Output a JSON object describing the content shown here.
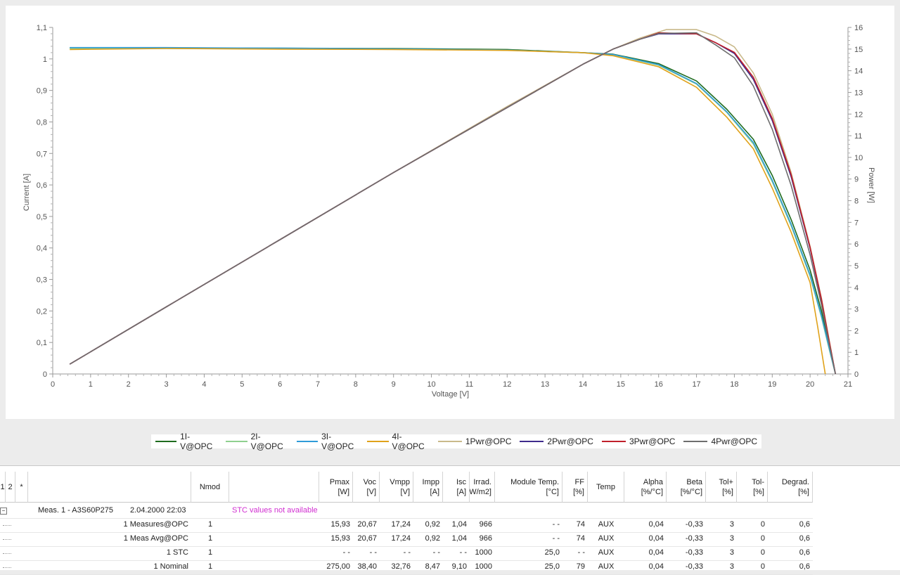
{
  "chart_data": {
    "type": "line",
    "xlabel": "Voltage [V]",
    "ylabel": "Current [A]",
    "y2label": "Power [W]",
    "xlim": [
      0,
      21
    ],
    "ylim": [
      0,
      1.1
    ],
    "y2lim": [
      0,
      16
    ],
    "x_ticks": [
      "0",
      "1",
      "2",
      "3",
      "4",
      "5",
      "6",
      "7",
      "8",
      "9",
      "10",
      "11",
      "12",
      "13",
      "14",
      "15",
      "16",
      "17",
      "18",
      "19",
      "20",
      "21"
    ],
    "y_ticks": [
      "0",
      "0,1",
      "0,2",
      "0,3",
      "0,4",
      "0,5",
      "0,6",
      "0,7",
      "0,8",
      "0,9",
      "1",
      "1,1"
    ],
    "y2_ticks": [
      "0",
      "1",
      "2",
      "3",
      "4",
      "5",
      "6",
      "7",
      "8",
      "9",
      "10",
      "11",
      "12",
      "13",
      "14",
      "15",
      "16"
    ],
    "grid": false,
    "legend_position": "bottom",
    "series": [
      {
        "name": "1I-V@OPC",
        "axis": "left",
        "color": "#1e6b1e",
        "x": [
          0.45,
          3,
          6,
          9,
          12,
          14,
          14.8,
          16,
          17,
          17.8,
          18.5,
          19,
          19.5,
          20,
          20.3,
          20.5,
          20.67
        ],
        "y": [
          1.035,
          1.035,
          1.034,
          1.033,
          1.03,
          1.02,
          1.015,
          0.985,
          0.93,
          0.84,
          0.745,
          0.63,
          0.49,
          0.33,
          0.2,
          0.09,
          0.0
        ]
      },
      {
        "name": "2I-V@OPC",
        "axis": "left",
        "color": "#8fd08f",
        "x": [
          0.45,
          3,
          6,
          9,
          12,
          14,
          14.8,
          16,
          17,
          17.8,
          18.5,
          19,
          19.5,
          20,
          20.3,
          20.5,
          20.67
        ],
        "y": [
          1.033,
          1.033,
          1.032,
          1.031,
          1.028,
          1.02,
          1.013,
          0.98,
          0.92,
          0.83,
          0.73,
          0.61,
          0.47,
          0.31,
          0.18,
          0.08,
          0.0
        ]
      },
      {
        "name": "3I-V@OPC",
        "axis": "left",
        "color": "#2f9bd8",
        "x": [
          0.45,
          3,
          6,
          9,
          12,
          14,
          14.8,
          16,
          17,
          17.8,
          18.5,
          19,
          19.5,
          20,
          20.3,
          20.5,
          20.67
        ],
        "y": [
          1.036,
          1.036,
          1.034,
          1.032,
          1.028,
          1.02,
          1.014,
          0.982,
          0.922,
          0.832,
          0.735,
          0.615,
          0.475,
          0.315,
          0.185,
          0.085,
          0.0
        ]
      },
      {
        "name": "4I-V@OPC",
        "axis": "left",
        "color": "#e0a21a",
        "x": [
          0.45,
          3,
          6,
          9,
          12,
          14,
          14.8,
          16,
          17,
          17.8,
          18.5,
          19,
          19.5,
          20,
          20.2,
          20.4
        ],
        "y": [
          1.03,
          1.033,
          1.031,
          1.03,
          1.027,
          1.02,
          1.01,
          0.975,
          0.91,
          0.815,
          0.715,
          0.59,
          0.45,
          0.29,
          0.15,
          0.0
        ]
      },
      {
        "name": "1Pwr@OPC",
        "axis": "right",
        "color": "#c9b98a",
        "x": [
          0.45,
          3,
          6,
          9,
          12,
          14,
          14.8,
          15.5,
          16.2,
          17,
          17.5,
          18,
          18.5,
          19,
          19.5,
          20,
          20.3,
          20.5,
          20.67
        ],
        "y": [
          0.45,
          3.1,
          6.2,
          9.3,
          12.35,
          14.3,
          15.0,
          15.5,
          15.9,
          15.9,
          15.6,
          15.1,
          13.9,
          12.0,
          9.3,
          5.9,
          3.5,
          1.6,
          0.0
        ]
      },
      {
        "name": "2Pwr@OPC",
        "axis": "right",
        "color": "#3f2b8c",
        "x": [
          0.45,
          3,
          6,
          9,
          12,
          14,
          14.8,
          15.5,
          16,
          17,
          17.5,
          18,
          18.5,
          19,
          19.5,
          20,
          20.3,
          20.5,
          20.67
        ],
        "y": [
          0.45,
          3.1,
          6.2,
          9.3,
          12.3,
          14.3,
          15.0,
          15.45,
          15.7,
          15.7,
          15.3,
          14.8,
          13.6,
          11.7,
          9.1,
          5.8,
          3.4,
          1.5,
          0.0
        ]
      },
      {
        "name": "3Pwr@OPC",
        "axis": "right",
        "color": "#c0202a",
        "x": [
          0.45,
          3,
          6,
          9,
          12,
          14,
          14.8,
          15.5,
          16,
          17,
          17.5,
          18,
          18.5,
          19,
          19.5,
          20,
          20.3,
          20.5,
          20.67
        ],
        "y": [
          0.45,
          3.1,
          6.2,
          9.3,
          12.3,
          14.3,
          15.0,
          15.45,
          15.75,
          15.7,
          15.3,
          14.85,
          13.7,
          11.8,
          9.2,
          5.85,
          3.45,
          1.55,
          0.0
        ]
      },
      {
        "name": "4Pwr@OPC",
        "axis": "right",
        "color": "#6e6e6e",
        "x": [
          0.45,
          3,
          6,
          9,
          12,
          14,
          14.8,
          15.5,
          16,
          17,
          17.5,
          18,
          18.5,
          19,
          19.5,
          20,
          20.3,
          20.5,
          20.67
        ],
        "y": [
          0.45,
          3.1,
          6.2,
          9.3,
          12.3,
          14.3,
          15.0,
          15.45,
          15.72,
          15.75,
          15.2,
          14.6,
          13.3,
          11.3,
          8.7,
          5.5,
          3.2,
          1.4,
          0.0
        ]
      }
    ]
  },
  "table": {
    "columns": [
      {
        "key": "c1",
        "label": "1",
        "unit": ""
      },
      {
        "key": "c2",
        "label": "2",
        "unit": ""
      },
      {
        "key": "c3",
        "label": "*",
        "unit": ""
      },
      {
        "key": "name",
        "label": "",
        "unit": ""
      },
      {
        "key": "nmod",
        "label": "Nmod",
        "unit": ""
      },
      {
        "key": "note",
        "label": "",
        "unit": ""
      },
      {
        "key": "pmax",
        "label": "Pmax",
        "unit": "[W]"
      },
      {
        "key": "voc",
        "label": "Voc",
        "unit": "[V]"
      },
      {
        "key": "vmpp",
        "label": "Vmpp",
        "unit": "[V]"
      },
      {
        "key": "impp",
        "label": "Impp",
        "unit": "[A]"
      },
      {
        "key": "isc",
        "label": "Isc",
        "unit": "[A]"
      },
      {
        "key": "irrad",
        "label": "Irrad.",
        "unit": "[W/m2]"
      },
      {
        "key": "mtemp",
        "label": "Module Temp.",
        "unit": "[°C]"
      },
      {
        "key": "ff",
        "label": "FF",
        "unit": "[%]"
      },
      {
        "key": "temp",
        "label": "Temp",
        "unit": ""
      },
      {
        "key": "alpha",
        "label": "Alpha",
        "unit": "[%/°C]"
      },
      {
        "key": "beta",
        "label": "Beta",
        "unit": "[%/°C]"
      },
      {
        "key": "tolp",
        "label": "Tol+",
        "unit": "[%]"
      },
      {
        "key": "tolm",
        "label": "Tol-",
        "unit": "[%]"
      },
      {
        "key": "degrad",
        "label": "Degrad.",
        "unit": "[%]"
      }
    ],
    "group": {
      "name": "Meas.  1 - A3S60P275",
      "date": "2.04.2000 22:03",
      "note": "STC values not available"
    },
    "rows": [
      {
        "name": "1 Measures@OPC",
        "nmod": "1",
        "pmax": "15,93",
        "voc": "20,67",
        "vmpp": "17,24",
        "impp": "0,92",
        "isc": "1,04",
        "irrad": "966",
        "mtemp": "- -",
        "ff": "74",
        "temp": "AUX",
        "alpha": "0,04",
        "beta": "-0,33",
        "tolp": "3",
        "tolm": "0",
        "degrad": "0,6"
      },
      {
        "name": "1  Meas Avg@OPC",
        "nmod": "1",
        "pmax": "15,93",
        "voc": "20,67",
        "vmpp": "17,24",
        "impp": "0,92",
        "isc": "1,04",
        "irrad": "966",
        "mtemp": "- -",
        "ff": "74",
        "temp": "AUX",
        "alpha": "0,04",
        "beta": "-0,33",
        "tolp": "3",
        "tolm": "0",
        "degrad": "0,6"
      },
      {
        "name": "1 STC",
        "nmod": "1",
        "pmax": "- -",
        "voc": "- -",
        "vmpp": "- -",
        "impp": "- -",
        "isc": "- -",
        "irrad": "1000",
        "mtemp": "25,0",
        "ff": "- -",
        "temp": "AUX",
        "alpha": "0,04",
        "beta": "-0,33",
        "tolp": "3",
        "tolm": "0",
        "degrad": "0,6"
      },
      {
        "name": "1 Nominal",
        "nmod": "1",
        "pmax": "275,00",
        "voc": "38,40",
        "vmpp": "32,76",
        "impp": "8,47",
        "isc": "9,10",
        "irrad": "1000",
        "mtemp": "25,0",
        "ff": "79",
        "temp": "AUX",
        "alpha": "0,04",
        "beta": "-0,33",
        "tolp": "3",
        "tolm": "0",
        "degrad": "0,6"
      }
    ]
  }
}
